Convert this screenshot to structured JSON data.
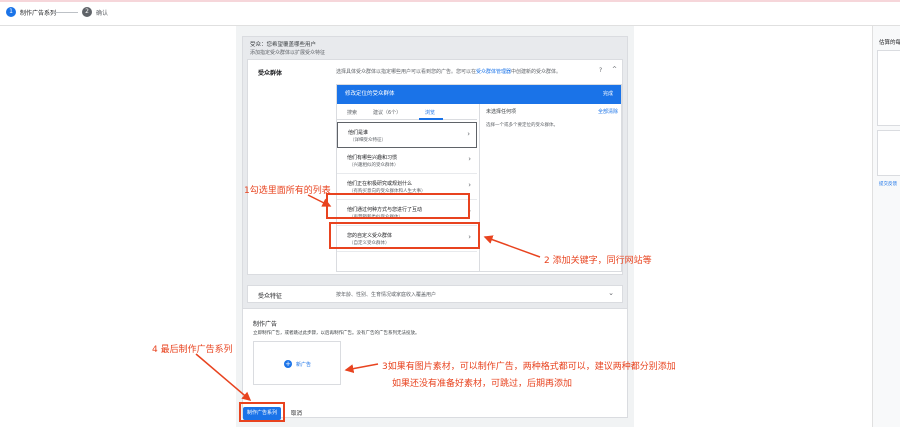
{
  "topbar": {
    "step1": {
      "num": "1",
      "label": "制作广告系列"
    },
    "step2": {
      "num": "2",
      "label": "确认"
    }
  },
  "audience": {
    "head": "受众：您希望覆盖哪些用户",
    "head_sub": "添加指定受众群体以扩展受众特征",
    "segment_label": "受众群体",
    "segment_desc": "选择具体受众群体以指定哪些用户可以看到您的广告。您可以在",
    "segment_link": "受众群体管理器",
    "segment_desc2": "中创建新的受众群体。",
    "help_icon": "?",
    "collapse_icon": "^",
    "picker_title": "修改定位的受众群体",
    "picker_done": "完成",
    "tabs": [
      "搜索",
      "建议（6个）",
      "浏览"
    ],
    "selected_title": "未选择任何项",
    "clear_all": "全部清除",
    "selected_hint": "选择一个或多个要定位的受众群体。",
    "items": [
      {
        "t1": "他们是谁",
        "t2": "（详细受众特征）"
      },
      {
        "t1": "他们有哪些兴趣和习惯",
        "t2": "（兴趣相似的受众群体）"
      },
      {
        "t1": "他们正在积极研究或规划什么",
        "t2": "（有购买意向的受众群体和人生大事）"
      },
      {
        "t1": "他们通过何种方式与您进行了互动",
        "t2": "（再营销和类似受众群体）"
      },
      {
        "t1": "您的自定义受众群体",
        "t2": "（自定义受众群体）"
      }
    ],
    "traits_label": "受众特征",
    "traits_desc": "按年龄、性别、生育情况或家庭收入覆盖用户"
  },
  "ads": {
    "title": "制作广告",
    "desc": "立即制作广告，或者跳过此步骤，以后再制作广告。没有广告的广告系列无法投放。",
    "new_ad": "新广告",
    "plus": "+"
  },
  "footer": {
    "create": "制作广告系列",
    "cancel": "取消"
  },
  "sidebar": {
    "title": "估算的每",
    "link": "提交反馈"
  },
  "annotations": {
    "a1": "1勾选里面所有的列表",
    "a2": "2 添加关键字，同行网站等",
    "a3_line1": "3如果有图片素材，可以制作广告，两种格式都可以，建议两种都分别添加",
    "a3_line2": "如果还没有准备好素材，可跳过，后期再添加",
    "a4": "4 最后制作广告系列"
  },
  "colors": {
    "accent": "#1a73e8",
    "annotation": "#e8431f"
  }
}
